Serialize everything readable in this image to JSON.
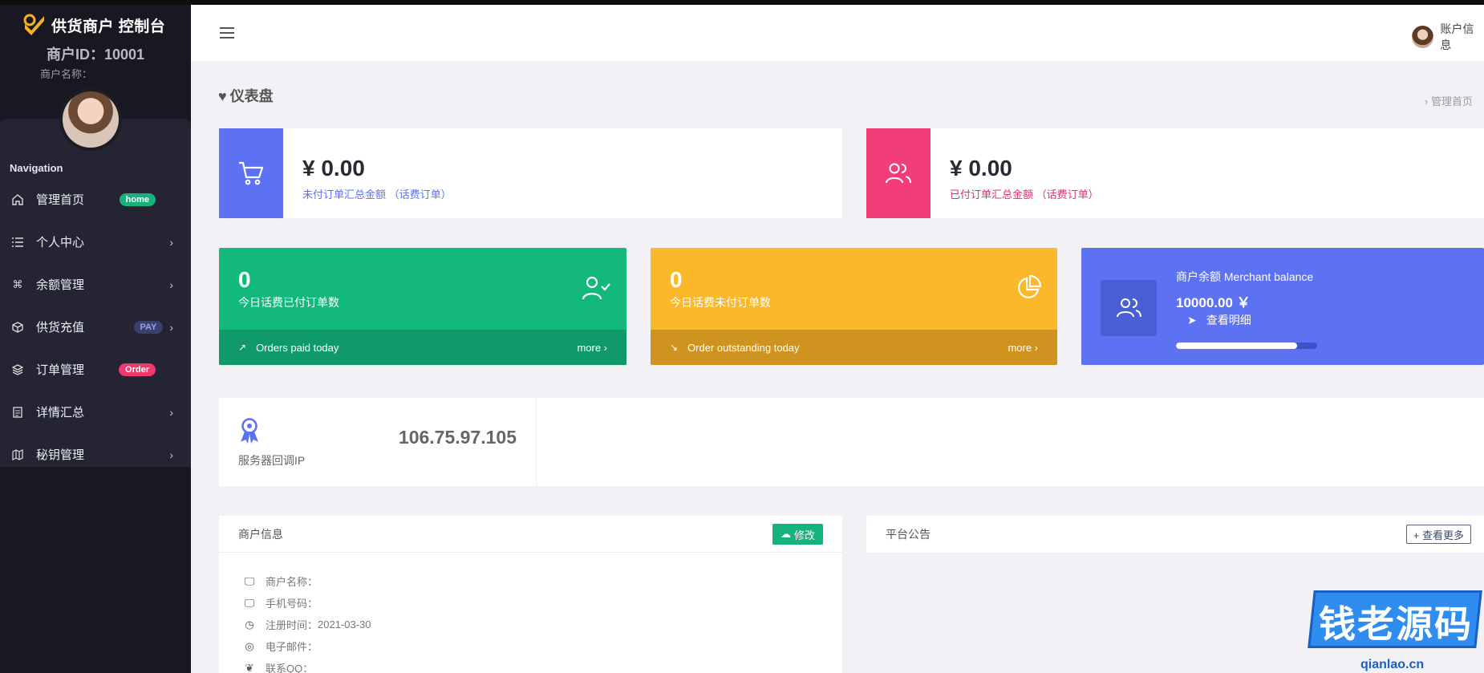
{
  "sidebar": {
    "brand": "供货商户 控制台",
    "merchant_id": "商户ID：10001",
    "merchant_name": "商户名称：",
    "nav_label": "Navigation",
    "items": [
      {
        "label": "管理首页",
        "icon": "home-icon",
        "badge": "home"
      },
      {
        "label": "个人中心",
        "icon": "list-icon"
      },
      {
        "label": "余额管理",
        "icon": "command-icon"
      },
      {
        "label": "供货充值",
        "icon": "box-icon",
        "badge": "PAY"
      },
      {
        "label": "订单管理",
        "icon": "layers-icon",
        "badge": "Order"
      },
      {
        "label": "详情汇总",
        "icon": "document-icon"
      },
      {
        "label": "秘钥管理",
        "icon": "map-icon"
      }
    ]
  },
  "header": {
    "account_label": "账户信息"
  },
  "page": {
    "title": "仪表盘",
    "breadcrumb": "› 管理首页"
  },
  "summary": [
    {
      "amount": "¥ 0.00",
      "label": "未付订单汇总金额 （话费订单）",
      "color": "#5c72f2",
      "label_color": "#5c72f2",
      "icon": "cart-icon"
    },
    {
      "amount": "¥ 0.00",
      "label": "已付订单汇总金额 （话费订单）",
      "color": "#f23d78",
      "label_color": "#e0316b",
      "icon": "users-icon"
    }
  ],
  "stats": [
    {
      "value": "0",
      "label": "今日话费已付订单数",
      "foot": "Orders paid today",
      "more": "more ›",
      "color": "#13b87b",
      "foot_color": "#10996a",
      "icon": "user-check-icon"
    },
    {
      "value": "0",
      "label": "今日话费未付订单数",
      "foot": "Order outstanding today",
      "more": "more ›",
      "color": "#fbb82b",
      "foot_color": "#cf941f",
      "icon": "pie-chart-icon"
    }
  ],
  "balance": {
    "title": "商户余额 Merchant balance",
    "amount": "10000.00 ￥",
    "detail": "查看明细",
    "progress": 0.86,
    "color": "#5c72f2"
  },
  "ip": {
    "value": "106.75.97.105",
    "label": "服务器回调IP"
  },
  "merchant_panel": {
    "title": "商户信息",
    "edit_label": "修改",
    "rows": [
      {
        "icon": "monitor-icon",
        "label": "商户名称：",
        "value": ""
      },
      {
        "icon": "monitor-icon",
        "label": "手机号码：",
        "value": ""
      },
      {
        "icon": "clock-icon",
        "label": "注册时间：",
        "value": "2021-03-30"
      },
      {
        "icon": "globe-icon",
        "label": "电子邮件：",
        "value": ""
      },
      {
        "icon": "twitter-icon",
        "label": "联系QQ：",
        "value": ""
      }
    ]
  },
  "notice_panel": {
    "title": "平台公告",
    "more_label": "+ 查看更多"
  },
  "watermark": {
    "text": "钱老源码",
    "url": "qianlao.cn"
  }
}
